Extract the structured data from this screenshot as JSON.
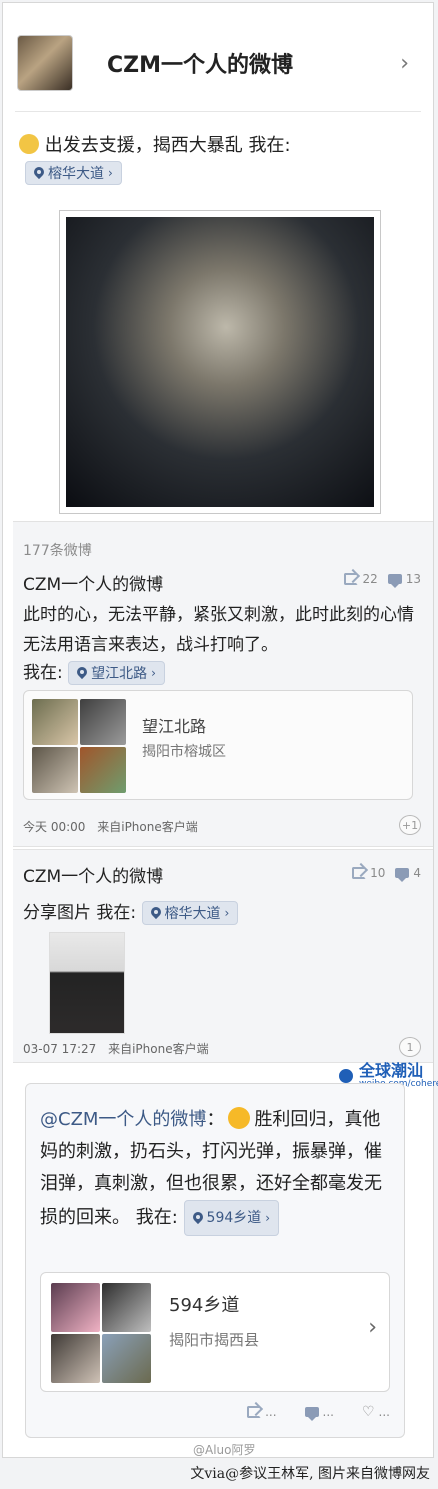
{
  "header": {
    "title": "CZM一个人的微博",
    "main_text": "出发去支援，揭西大暴乱 我在:",
    "location": "榕华大道"
  },
  "posts": [
    {
      "count_label": "177条微博",
      "author": "CZM一个人的微博",
      "reposts": "22",
      "comments": "13",
      "text": "此时的心，无法平静，紧张又刺激，此时此刻的心情无法用语言来表达，战斗打响了。",
      "location_prefix": "我在:",
      "location": "望江北路",
      "place_card": {
        "name": "望江北路",
        "address": "揭阳市榕城区"
      },
      "time": "今天 00:00",
      "source": "来自iPhone客户端",
      "like": "+1"
    },
    {
      "author": "CZM一个人的微博",
      "reposts": "10",
      "comments": "4",
      "text": "分享图片 我在:",
      "location": "榕华大道",
      "time": "03-07 17:27",
      "source": "来自iPhone客户端",
      "like": "1"
    }
  ],
  "watermark": {
    "brand": "全球潮汕",
    "url": "weibo.com/cohere"
  },
  "retweet": {
    "author": "@CZM一个人的微博",
    "separator": "：",
    "text_line1": "胜利回归，",
    "text_rest": "真他妈的刺激，扔石头，打闪光弹，振暴弹，催泪弹，真刺激，但也很累，还好全都毫发无损的回来。 我在:",
    "location": "594乡道",
    "place_card": {
      "name": "594乡道",
      "address": "揭阳市揭西县"
    },
    "actions": [
      "...",
      "...",
      "..."
    ]
  },
  "footer": {
    "username": "@Aluo阿罗",
    "credit": "文via@参议王林军, 图片来自微博网友"
  },
  "colors": {
    "link": "#3d5a86",
    "background": "#f2f3f5",
    "muted": "#7f7f7f"
  }
}
